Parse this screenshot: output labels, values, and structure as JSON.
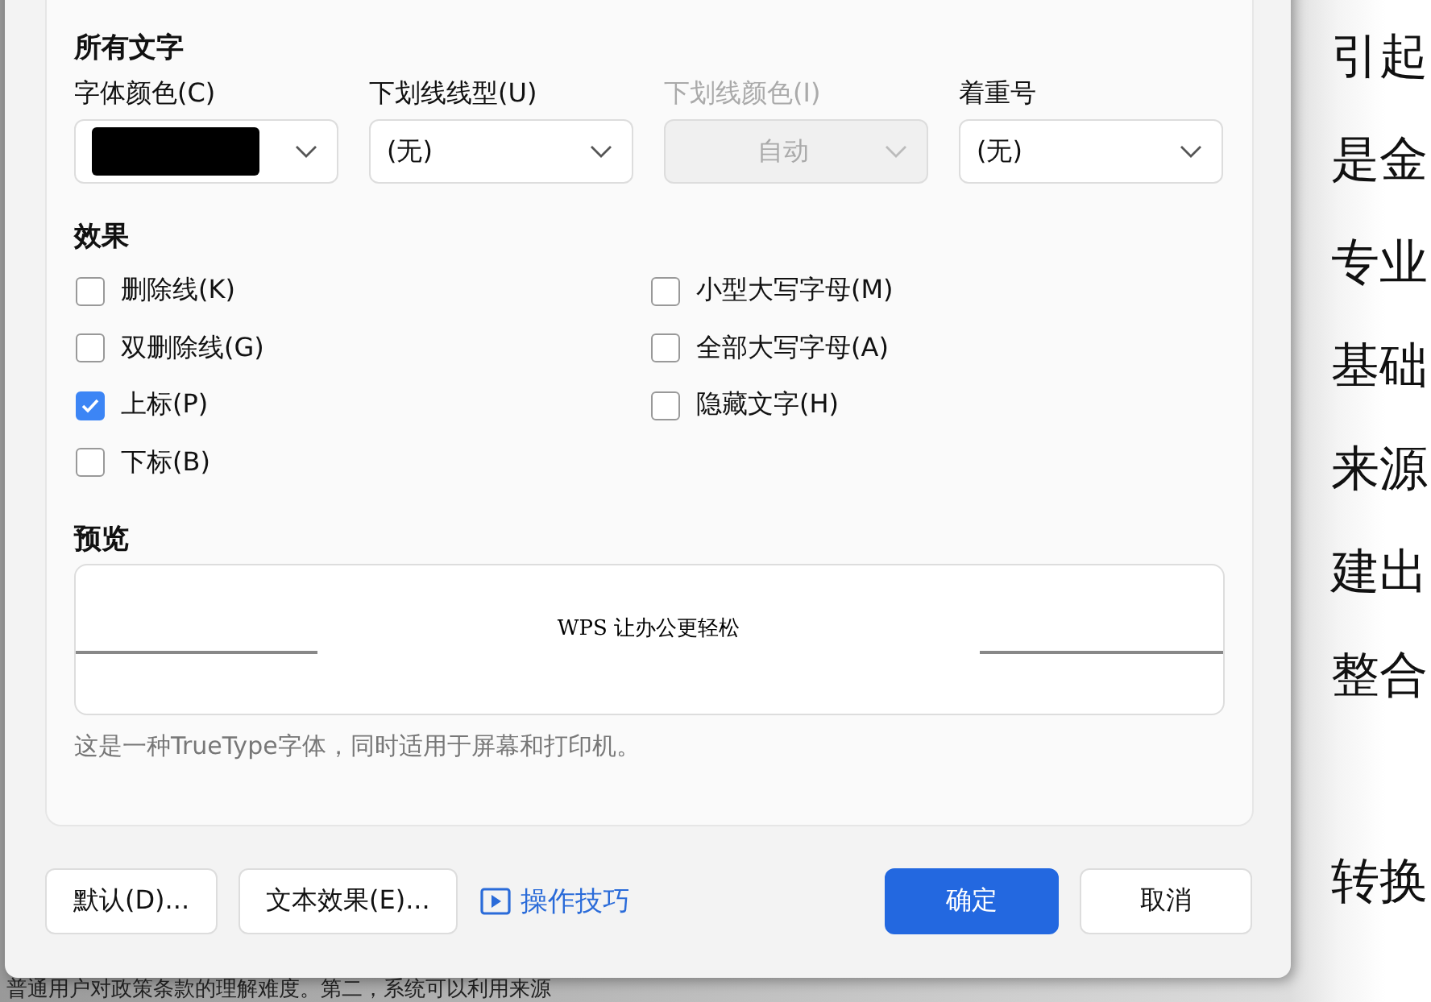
{
  "document": {
    "blocks": [
      {
        "lines": [
          "引起",
          "是金",
          "专业",
          "基础",
          "来源",
          "建出",
          "整合"
        ]
      },
      {
        "lines": [
          "转换"
        ]
      }
    ],
    "bottom_line": "普通用户对政策条款的理解难度。第二，系统可以利用来源"
  },
  "dialog": {
    "section_all_text": "所有文字",
    "fields": [
      {
        "label": "字体颜色(C)",
        "kind": "color",
        "color": "#000000",
        "disabled": false
      },
      {
        "label": "下划线线型(U)",
        "kind": "select",
        "value": "(无)",
        "disabled": false
      },
      {
        "label": "下划线颜色(I)",
        "kind": "select",
        "value": "自动",
        "disabled": true
      },
      {
        "label": "着重号",
        "kind": "select",
        "value": "(无)",
        "disabled": false
      }
    ],
    "section_effects": "效果",
    "effects": [
      {
        "label": "删除线(K)",
        "checked": false
      },
      {
        "label": "双删除线(G)",
        "checked": false
      },
      {
        "label": "上标(P)",
        "checked": true
      },
      {
        "label": "下标(B)",
        "checked": false
      },
      {
        "label": "小型大写字母(M)",
        "checked": false
      },
      {
        "label": "全部大写字母(A)",
        "checked": false
      },
      {
        "label": "隐藏文字(H)",
        "checked": false
      }
    ],
    "section_preview": "预览",
    "preview_text": "WPS 让办公更轻松",
    "note": "这是一种TrueType字体，同时适用于屏幕和打印机。",
    "buttons": [
      {
        "label": "默认(D)...",
        "kind": "plain"
      },
      {
        "label": "文本效果(E)...",
        "kind": "plain"
      },
      {
        "label": "操作技巧",
        "kind": "link"
      },
      {
        "label": "确定",
        "kind": "primary"
      },
      {
        "label": "取消",
        "kind": "plain"
      }
    ]
  }
}
